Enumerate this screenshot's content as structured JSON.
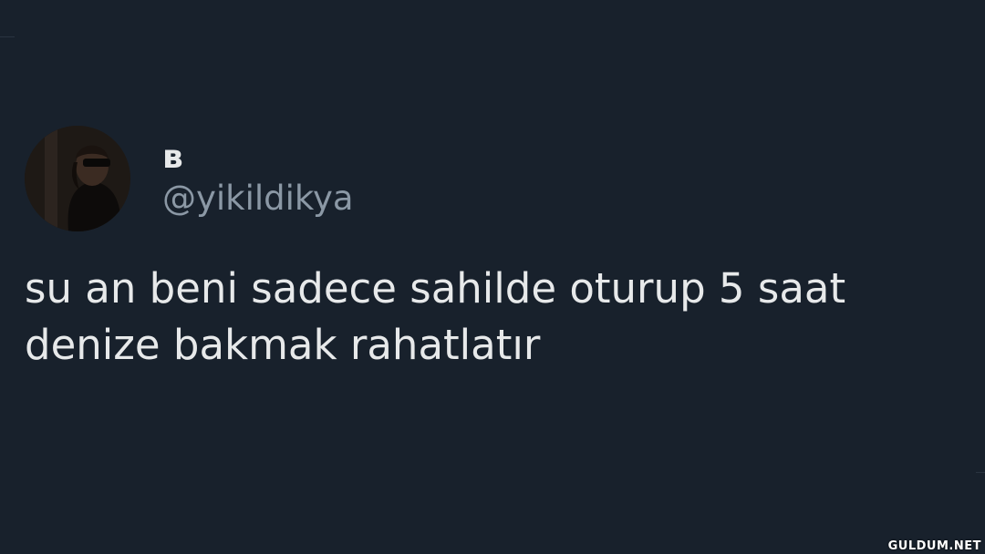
{
  "tweet": {
    "display_name": "ʙ",
    "handle": "@yikildikya",
    "text": "su an beni sadece sahilde oturup 5 saat denize bakmak rahatlatır"
  },
  "watermark": "GULDUM.NET",
  "colors": {
    "background": "#18212c",
    "primary_text": "#e7e9ea",
    "secondary_text": "#8b98a5"
  }
}
